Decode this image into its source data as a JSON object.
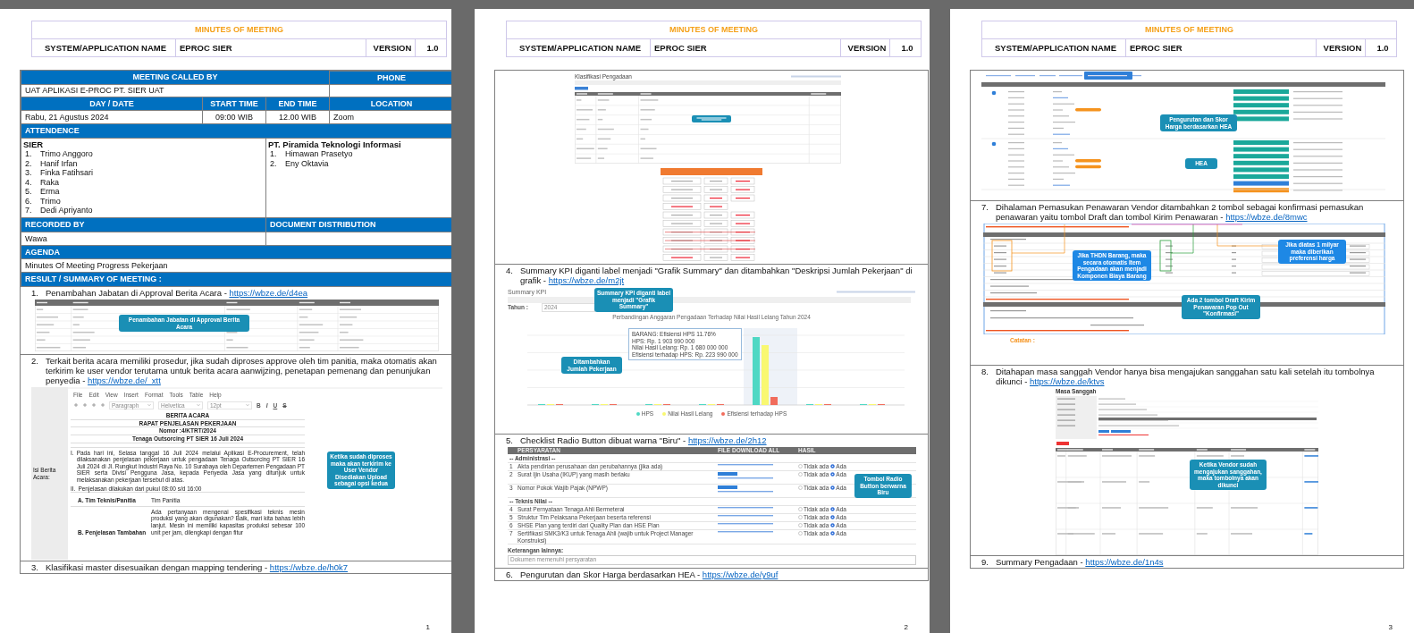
{
  "pages": [
    {
      "header": {
        "title": "MINUTES OF MEETING",
        "system_label": "SYSTEM/APPLICATION NAME",
        "system_value": "EPROC SIER",
        "version_label": "VERSION",
        "version_value": "1.0"
      },
      "meeting": {
        "called_by_label": "MEETING  CALLED  BY",
        "phone_label": "PHONE",
        "called_by": "UAT APLIKASI E-PROC PT. SIER UAT",
        "day_label": "DAY / DATE",
        "start_label": "START TIME",
        "end_label": "END TIME",
        "location_label": "LOCATION",
        "date": "Rabu, 21 Agustus 2024",
        "start": "09:00 WIB",
        "end": "12.00 WIB",
        "location": "Zoom",
        "attendance_label": "ATTENDENCE",
        "groups": [
          {
            "name": "SIER",
            "members": [
              {
                "number": "1.",
                "name": "Trimo Anggoro"
              },
              {
                "number": "2.",
                "name": "Hanif Irfan"
              },
              {
                "number": "3.",
                "name": "Finka Fatihsari"
              },
              {
                "number": "4.",
                "name": "Raka"
              },
              {
                "number": "5.",
                "name": "Erma"
              },
              {
                "number": "6.",
                "name": "Trimo"
              },
              {
                "number": "7.",
                "name": "Dedi Apriyanto"
              }
            ]
          },
          {
            "name": "PT. Piramida Teknologi Informasi",
            "members": [
              {
                "number": "1.",
                "name": "Himawan Prasetyo"
              },
              {
                "number": "2.",
                "name": "Eny Oktavia"
              }
            ]
          }
        ],
        "recorded_label": "RECORDED  BY",
        "distribution_label": "DOCUMENT DISTRIBUTION",
        "recorded_by": "Wawa",
        "agenda_label": "AGENDA",
        "agenda": "Minutes Of Meeting Progress Pekerjaan",
        "result_label": "RESULT / SUMMARY OF MEETING :"
      },
      "blocks": [
        {
          "kind": "item",
          "number": "1.",
          "text": "Penambahan Jabatan di Approval Berita Acara - ",
          "link": "https://wbze.de/d4ea"
        },
        {
          "kind": "jabatan",
          "callout": "Penambahan Jabatan di Approval Berita Acara"
        },
        {
          "kind": "item",
          "number": "2.",
          "text": "Terkait berita acara memiliki prosedur, jika sudah diproses approve oleh tim panitia, maka otomatis akan terkirim ke user vendor terutama untuk berita acara aanwijzing, penetapan pemenang dan penunjukan penyedia - ",
          "link": "https://wbze.de/_xtt"
        },
        {
          "kind": "editor",
          "side_label": "Isi Berita Acara:",
          "menu": [
            "File",
            "Edit",
            "View",
            "Insert",
            "Format",
            "Tools",
            "Table",
            "Help"
          ],
          "selects": [
            "Paragraph",
            "Helvetica",
            "12pt"
          ],
          "format_buttons": [
            "B",
            "I",
            "U",
            "S"
          ],
          "title_lines": [
            "BERITA ACARA",
            "RAPAT PENJELASAN PEKERJAAN",
            "Nomor :4/KTRT/2024",
            "Tenaga Outsorcing PT SIER 16 Juli 2024"
          ],
          "paragraphs": [
            {
              "number": "I.",
              "text": "Pada hari ini, Selasa tanggal 16 Juli 2024 melalui Aplikasi E-Procurement, telah dilaksanakan penjelasan pekerjaan untuk pengadaan Tenaga Outsorcing PT SIER 16 Juli 2024 di Jl. Rungkut Industri Raya No. 10 Surabaya oleh Departemen Pengadaan PT SIER serta Divisi Pengguna Jasa, kepada Penyedia Jasa yang ditunjuk untuk melaksanakan pekerjaan tersebut di atas."
            },
            {
              "number": "II.",
              "text": "Penjelasan dilakukan dari pukul 08:00 s/d 16:00"
            }
          ],
          "rows": [
            {
              "label": "A. Tim Teknis/Panitia",
              "value": "Tim Panitia"
            },
            {
              "label": "B. Penjelasan Tambahan",
              "value": "Ada pertanyaan mengenai spesifikasi teknis mesin produksi yang akan digunakan? Baik, mari kita bahas lebih lanjut. Mesin ini memiliki kapasitas produksi sebesar 100 unit per jam, dilengkapi dengan fitur"
            }
          ],
          "callout": "Ketika sudah diproses maka akan terkirim ke User Vendor Disediakan Upload sebagai opsi kedua"
        },
        {
          "kind": "item",
          "number": "3.",
          "text": "Klasifikasi master disesuaikan dengan mapping tendering - ",
          "link": "https://wbze.de/h0k7"
        }
      ],
      "page_number": "1"
    },
    {
      "header": {
        "title": "MINUTES OF MEETING",
        "system_label": "SYSTEM/APPLICATION NAME",
        "system_value": "EPROC SIER",
        "version_label": "VERSION",
        "version_value": "1.0"
      },
      "blocks": [
        {
          "kind": "classification",
          "title": "Klasifikasi Pengadaan"
        },
        {
          "kind": "item",
          "number": "4.",
          "text": "Summary KPI diganti label menjadi \"Grafik Summary\" dan ditambahkan \"Deskripsi Jumlah Pekerjaan\" di grafik - ",
          "link": "https://wbze.de/m2jt"
        },
        {
          "kind": "kpi",
          "title": "Summary KPI",
          "callout": "Summary KPI diganti label menjadi \"Grafik Summary\"",
          "year_label": "Tahun :",
          "year": "2024",
          "chart_title": "Perbandingan Anggaran Pengadaan Terhadap Nilai Hasil Lelang Tahun 2024",
          "tooltip": [
            "BARANG: Efisiensi HPS 11.76%",
            "HPS: Rp. 1 903 990 000",
            "Nilai Hasil Lelang: Rp. 1 680 000 000",
            "Efisiensi terhadap HPS: Rp. 223 990 000"
          ],
          "chart_callout": "Ditambahkan Jumlah Pekerjaan",
          "legend": [
            {
              "label": "HPS",
              "color": "#4fd8c4"
            },
            {
              "label": "Nilai Hasil Lelang",
              "color": "#f9f871"
            },
            {
              "label": "Efisiensi terhadap HPS",
              "color": "#f16c5c"
            }
          ]
        },
        {
          "kind": "item",
          "number": "5.",
          "text": "Checklist Radio Button dibuat warna \"Biru\" - ",
          "link": "https://wbze.de/2h12"
        },
        {
          "kind": "checklist",
          "headers": [
            "PERSYARATAN",
            "FILE",
            "DOWNLOAD ALL",
            "HASIL"
          ],
          "callout": "Tombol Radio Button berwarna Biru",
          "note_label": "Keterangan lainnya:",
          "note": "Dokumen memenuhi persyaratan",
          "sections": [
            {
              "title": "-- Administrasi --",
              "rows": [
                {
                  "number": "1",
                  "text": "Akta pendirian perusahaan dan perubahannya (jika ada)",
                  "options": [
                    {
                      "label": "Tidak ada",
                      "selected": false
                    },
                    {
                      "label": "Ada",
                      "selected": true
                    }
                  ]
                },
                {
                  "number": "2",
                  "text": "Surat Ijin Usaha (IKUP) yang masih berlaku",
                  "options": [
                    {
                      "label": "Tidak ada",
                      "selected": false
                    },
                    {
                      "label": "Ada",
                      "selected": true
                    }
                  ]
                },
                {
                  "number": "3",
                  "text": "Nomor Pokok Wajib Pajak (NPWP)",
                  "options": [
                    {
                      "label": "Tidak ada",
                      "selected": false
                    },
                    {
                      "label": "Ada",
                      "selected": true
                    }
                  ]
                }
              ]
            },
            {
              "title": "-- Teknis Nilai --",
              "rows": [
                {
                  "number": "4",
                  "text": "Surat Pernyataan Tenaga Ahli Bermeterai",
                  "options": [
                    {
                      "label": "Tidak ada",
                      "selected": false
                    },
                    {
                      "label": "Ada",
                      "selected": true
                    }
                  ]
                },
                {
                  "number": "5",
                  "text": "Struktur Tim Pelaksana Pekerjaan beserta referensi",
                  "options": [
                    {
                      "label": "Tidak ada",
                      "selected": false
                    },
                    {
                      "label": "Ada",
                      "selected": true
                    }
                  ]
                },
                {
                  "number": "6",
                  "text": "SHSE Plan yang terdiri dari Quality Plan dan HSE Plan",
                  "options": [
                    {
                      "label": "Tidak ada",
                      "selected": false
                    },
                    {
                      "label": "Ada",
                      "selected": true
                    }
                  ]
                },
                {
                  "number": "7",
                  "text": "Sertifikasi SMK3/K3 untuk Tenaga Ahli (wajib untuk Project Manager Konstruksi)",
                  "options": [
                    {
                      "label": "Tidak ada",
                      "selected": false
                    },
                    {
                      "label": "Ada",
                      "selected": true
                    }
                  ]
                }
              ]
            }
          ]
        },
        {
          "kind": "item",
          "number": "6.",
          "text": "Pengurutan dan Skor Harga berdasarkan HEA - ",
          "link": "https://wbze.de/y9uf"
        }
      ],
      "page_number": "2"
    },
    {
      "header": {
        "title": "MINUTES OF MEETING",
        "system_label": "SYSTEM/APPLICATION NAME",
        "system_value": "EPROC SIER",
        "version_label": "VERSION",
        "version_value": "1.0"
      },
      "blocks": [
        {
          "kind": "hea",
          "callout": "Pengurutan dan Skor Harga berdasarkan HEA",
          "callout2": "HEA"
        },
        {
          "kind": "item",
          "number": "7.",
          "text": "Dihalaman Pemasukan Penawaran Vendor ditambahkan 2 tombol sebagai konfirmasi pemasukan penawaran yaitu tombol Draft dan tombol Kirim Penawaran - ",
          "link": "https://wbze.de/8mwc"
        },
        {
          "kind": "offer",
          "callouts": [
            "Jika THDN Barang, maka secara otomatis Item Pengadaan akan menjadi Komponen Biaya Barang",
            "Jika diatas 1 milyar maka diberikan preferensi harga",
            "Ada 2 tombol Draft Kirim Penawaran Pop Out \"Konfirmasi\""
          ],
          "note": "Catatan :"
        },
        {
          "kind": "item",
          "number": "8.",
          "text": "Ditahapan masa sanggah Vendor hanya bisa mengajukan sanggahan satu kali setelah itu tombolnya dikunci - ",
          "link": "https://wbze.de/ktvs"
        },
        {
          "kind": "rebuttal",
          "title": "Masa Sanggah",
          "callout": "Ketika Vendor sudah mengajukan sanggahan, maka tombolnya akan dikunci"
        },
        {
          "kind": "item",
          "number": "9.",
          "text": "Summary Pengadaan - ",
          "link": "https://wbze.de/1n4s"
        }
      ],
      "page_number": "3"
    }
  ]
}
